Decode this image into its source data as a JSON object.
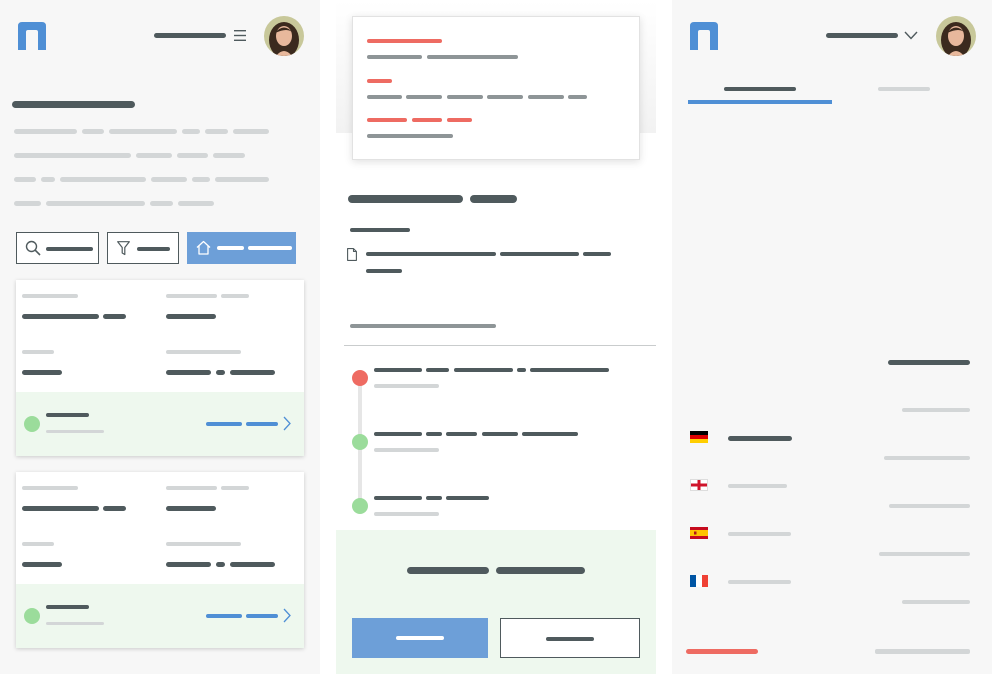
{
  "icons": {
    "logo": "logo-arch-icon",
    "menu": "hamburger-menu-icon",
    "dropdown": "chevron-down-icon",
    "search": "search-icon",
    "filter": "filter-icon",
    "home": "home-icon",
    "chevron": "chevron-right-icon",
    "document": "document-icon"
  },
  "colors": {
    "accent_blue": "#4f8fd5",
    "button_blue": "#6d9fd8",
    "status_red": "#ee6b62",
    "status_green": "#9bdc9b",
    "card_footer_green": "#eef8ee",
    "text_dark": "#4f5a5d",
    "text_light": "#d3d6d7"
  },
  "language_flags": [
    "flag-germany-icon",
    "flag-england-icon",
    "flag-spain-icon",
    "flag-france-icon"
  ],
  "timeline_status": [
    "red",
    "green",
    "green"
  ],
  "tabs": {
    "active_index": 0,
    "count": 2
  }
}
